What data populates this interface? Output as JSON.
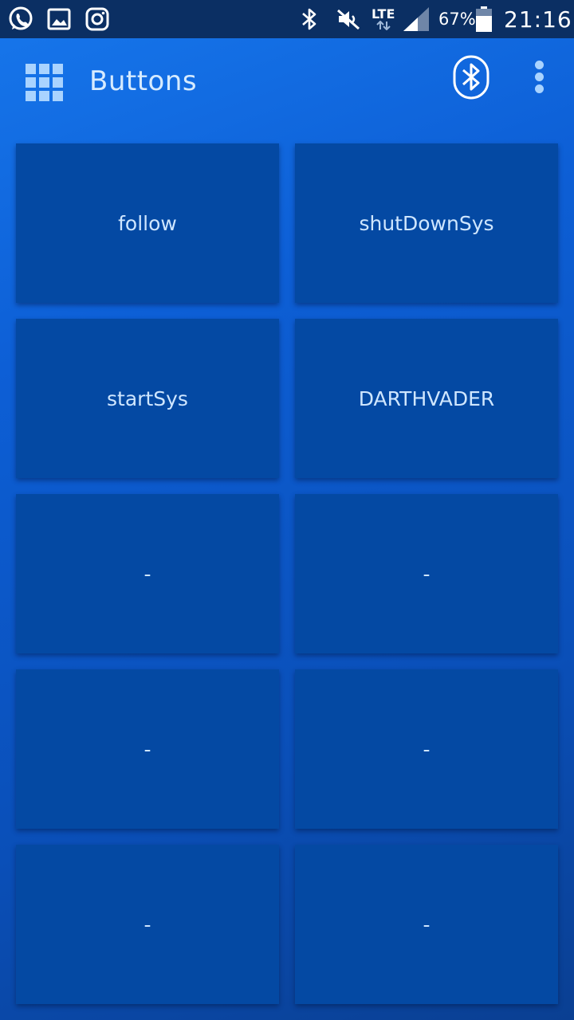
{
  "status_bar": {
    "battery": "67%",
    "time": "21:16",
    "network": "LTE",
    "icons": [
      "whatsapp-icon",
      "gallery-icon",
      "instagram-icon",
      "bluetooth-icon",
      "mute-icon",
      "signal-icon",
      "battery-icon"
    ]
  },
  "app_bar": {
    "title": "Buttons",
    "icons": [
      "grid-menu-icon",
      "bluetooth-icon",
      "more-vert-icon"
    ]
  },
  "buttons": [
    "follow",
    "shutDownSys",
    "startSys",
    "DARTHVADER",
    "-",
    "-",
    "-",
    "-",
    "-",
    "-"
  ],
  "colors": {
    "status_bar": "#0b2f63",
    "background": "#0d5fd6",
    "tile": "#0449a3",
    "tile_text": "#cfe6ff",
    "icon_light": "#a9d3ff"
  }
}
